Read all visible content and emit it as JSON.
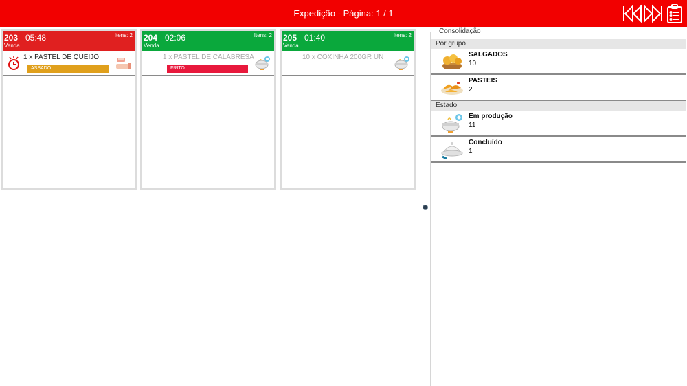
{
  "header": {
    "title": "Expedição - Página: 1 / 1",
    "bg_color": "#f20000",
    "buttons": [
      {
        "name": "first-page-button",
        "icon": "skip-back-icon"
      },
      {
        "name": "next-page-button",
        "icon": "skip-forward-icon"
      },
      {
        "name": "report-button",
        "icon": "clipboard-icon"
      }
    ]
  },
  "orders": [
    {
      "number": "203",
      "time": "05:48",
      "items_label": "Itens: 2",
      "type": "Venda",
      "header_color": "#e02020",
      "item": {
        "desc": "1 x PASTEL DE QUEIJO",
        "tag": "ASSADO",
        "tag_color": "#e0a01c",
        "dim": false,
        "lead_icon": "alarm-clock-icon",
        "state_icon": "hand-serving-icon"
      }
    },
    {
      "number": "204",
      "time": "02:06",
      "items_label": "Itens: 2",
      "type": "Venda",
      "header_color": "#0aa83c",
      "item": {
        "desc": "1 x PASTEL DE CALABRESA",
        "tag": "FRITO",
        "tag_color": "#e8193c",
        "dim": true,
        "lead_icon": "",
        "state_icon": "cooking-pot-icon"
      }
    },
    {
      "number": "205",
      "time": "01:40",
      "items_label": "Itens: 2",
      "type": "Venda",
      "header_color": "#0aa83c",
      "item": {
        "desc": "10 x COXINHA 200GR UN",
        "tag": "",
        "tag_color": "",
        "dim": true,
        "lead_icon": "",
        "state_icon": "cooking-pot-icon"
      }
    }
  ],
  "consolidation": {
    "legend": "Consolidação",
    "group_header": "Por grupo",
    "groups": [
      {
        "label": "SALGADOS",
        "count": "10",
        "icon": "salgados-basket-icon"
      },
      {
        "label": "PASTEIS",
        "count": "2",
        "icon": "pasteis-plate-icon"
      }
    ],
    "state_header": "Estado",
    "states": [
      {
        "label": "Em produção",
        "count": "11",
        "icon": "cooking-pot-icon"
      },
      {
        "label": "Concluído",
        "count": "1",
        "icon": "cloche-icon"
      }
    ]
  }
}
